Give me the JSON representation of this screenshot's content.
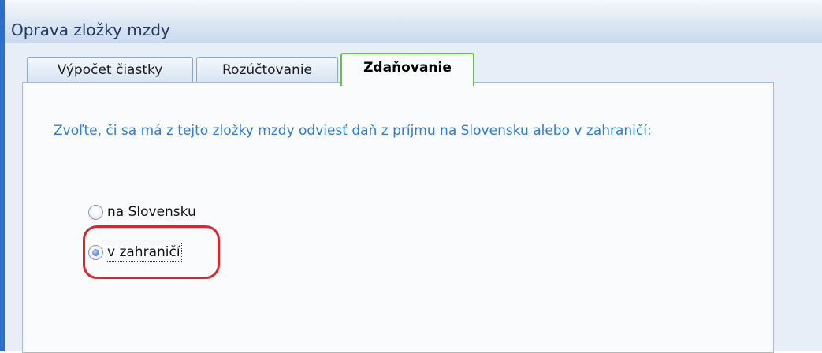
{
  "window": {
    "title": "Oprava zložky mzdy"
  },
  "tabs": [
    {
      "label": "Výpočet čiastky"
    },
    {
      "label": "Rozúčtovanie"
    },
    {
      "label": "Zdaňovanie",
      "active": true
    }
  ],
  "panel": {
    "question": "Zvoľte, či sa má z tejto zložky mzdy odviesť daň z príjmu na Slovensku alebo v zahraničí:",
    "options": [
      {
        "label": "na Slovensku",
        "checked": false
      },
      {
        "label": "v zahraničí",
        "checked": true
      }
    ]
  },
  "colors": {
    "question_text": "#2e7ad8",
    "active_tab_border": "#6cc04a",
    "highlight": "#e0242a",
    "window_border": "#2a6fc9"
  }
}
